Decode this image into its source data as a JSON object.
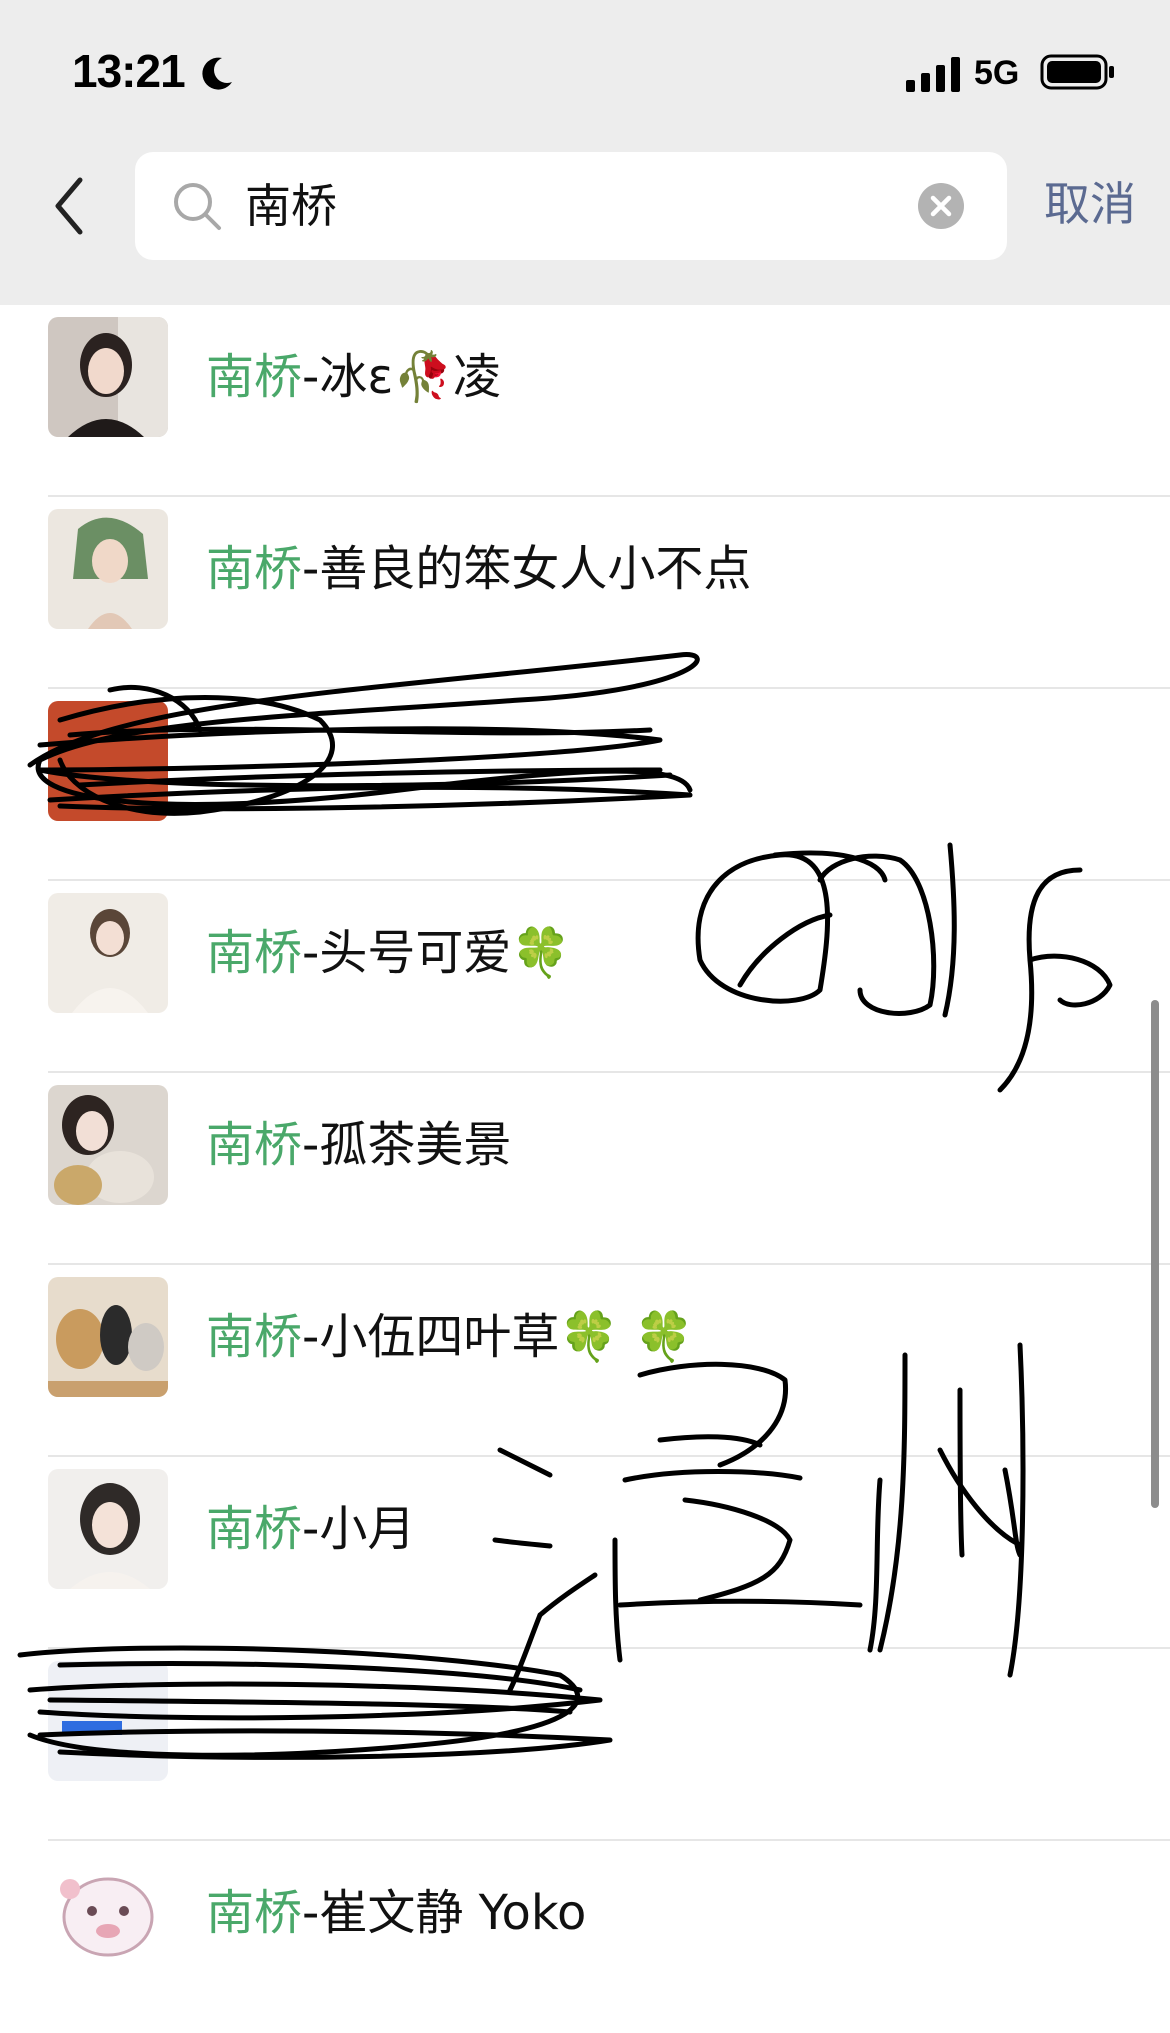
{
  "status_bar": {
    "time": "13:21",
    "network": "5G"
  },
  "search": {
    "query": "南桥",
    "cancel_label": "取消"
  },
  "results": [
    {
      "prefix": "南桥",
      "suffix": "-冰ε🥀凌",
      "avatar_colors": [
        "#cfc7c1",
        "#3a2e2b"
      ]
    },
    {
      "prefix": "南桥",
      "suffix": "-善良的笨女人小不点",
      "avatar_colors": [
        "#e4ddd4",
        "#6b8f64"
      ]
    },
    {
      "prefix": "",
      "suffix": "",
      "avatar_colors": [
        "#c44a2b",
        "#111111"
      ]
    },
    {
      "prefix": "南桥",
      "suffix": "-头号可爱🍀",
      "avatar_colors": [
        "#f0ece6",
        "#b7a79a"
      ]
    },
    {
      "prefix": "南桥",
      "suffix": "-孤茶美景",
      "avatar_colors": [
        "#dcd6cf",
        "#4b3f38"
      ]
    },
    {
      "prefix": "南桥",
      "suffix": "-小伍四叶草🍀 🍀",
      "avatar_colors": [
        "#c99b5e",
        "#2b2b2b"
      ]
    },
    {
      "prefix": "南桥",
      "suffix": "-小月",
      "avatar_colors": [
        "#f1efed",
        "#2f2a28"
      ]
    },
    {
      "prefix": "",
      "suffix": "",
      "avatar_colors": [
        "#2f6de0",
        "#111111"
      ]
    },
    {
      "prefix": "南桥",
      "suffix": "-崔文静 Yoko",
      "avatar_colors": [
        "#f6eef2",
        "#e7a6b5"
      ]
    }
  ],
  "colors": {
    "highlight": "#4aa86a",
    "cancel": "#5b6a91",
    "top_bg": "#ededed"
  }
}
